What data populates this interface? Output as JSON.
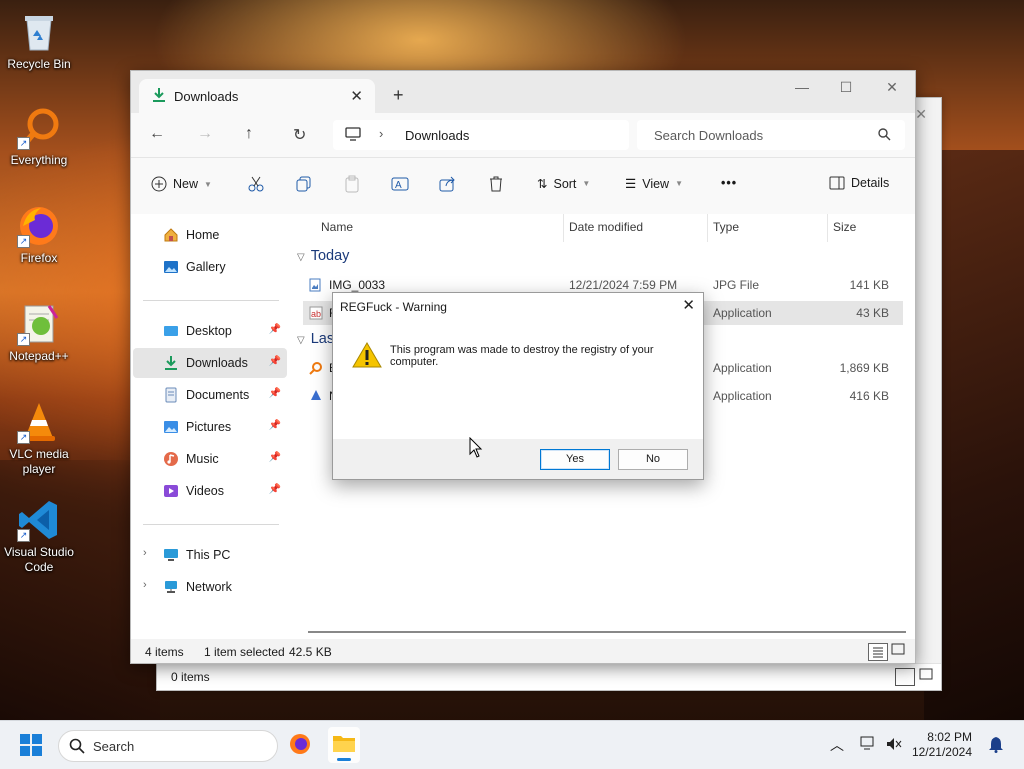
{
  "desktop": {
    "icons": [
      {
        "label": "Recycle Bin",
        "icon": "recycle-bin-icon"
      },
      {
        "label": "Everything",
        "icon": "everything-search-icon"
      },
      {
        "label": "Firefox",
        "icon": "firefox-icon"
      },
      {
        "label": "Notepad++",
        "icon": "notepad-plus-plus-icon"
      },
      {
        "label": "VLC media player",
        "icon": "vlc-icon"
      },
      {
        "label": "Visual Studio Code",
        "icon": "vscode-icon"
      }
    ]
  },
  "back_window": {
    "status_text": "0 items"
  },
  "explorer": {
    "tab_title": "Downloads",
    "breadcrumb": "Downloads",
    "search_placeholder": "Search Downloads",
    "toolbar": {
      "new_label": "New",
      "sort_label": "Sort",
      "view_label": "View",
      "more_label": "•••",
      "details_label": "Details"
    },
    "sidebar": {
      "top": [
        {
          "label": "Home",
          "icon": "home-icon"
        },
        {
          "label": "Gallery",
          "icon": "gallery-icon"
        }
      ],
      "quick": [
        {
          "label": "Desktop",
          "icon": "desktop-folder-icon"
        },
        {
          "label": "Downloads",
          "icon": "downloads-folder-icon"
        },
        {
          "label": "Documents",
          "icon": "documents-folder-icon"
        },
        {
          "label": "Pictures",
          "icon": "pictures-folder-icon"
        },
        {
          "label": "Music",
          "icon": "music-folder-icon"
        },
        {
          "label": "Videos",
          "icon": "videos-folder-icon"
        }
      ],
      "bottom": [
        {
          "label": "This PC",
          "icon": "this-pc-icon"
        },
        {
          "label": "Network",
          "icon": "network-icon"
        }
      ]
    },
    "columns": [
      "Name",
      "Date modified",
      "Type",
      "Size"
    ],
    "groups": [
      {
        "label": "Today",
        "rows": [
          {
            "name": "IMG_0033",
            "date": "12/21/2024 7:59 PM",
            "type": "JPG File",
            "size": "141 KB"
          },
          {
            "name": "R",
            "date": "",
            "type": "Application",
            "size": "43 KB"
          }
        ]
      },
      {
        "label": "Las",
        "rows": [
          {
            "name": "E",
            "date": "",
            "type": "Application",
            "size": "1,869 KB"
          },
          {
            "name": "N",
            "date": "",
            "type": "Application",
            "size": "416 KB"
          }
        ]
      }
    ],
    "status": {
      "count": "4 items",
      "selected": "1 item selected",
      "size": "42.5 KB"
    }
  },
  "dialog": {
    "title": "REGFuck - Warning",
    "message": "This program was made to destroy the registry of your computer.",
    "yes_label": "Yes",
    "no_label": "No"
  },
  "taskbar": {
    "search_label": "Search",
    "time": "8:02 PM",
    "date": "12/21/2024"
  }
}
